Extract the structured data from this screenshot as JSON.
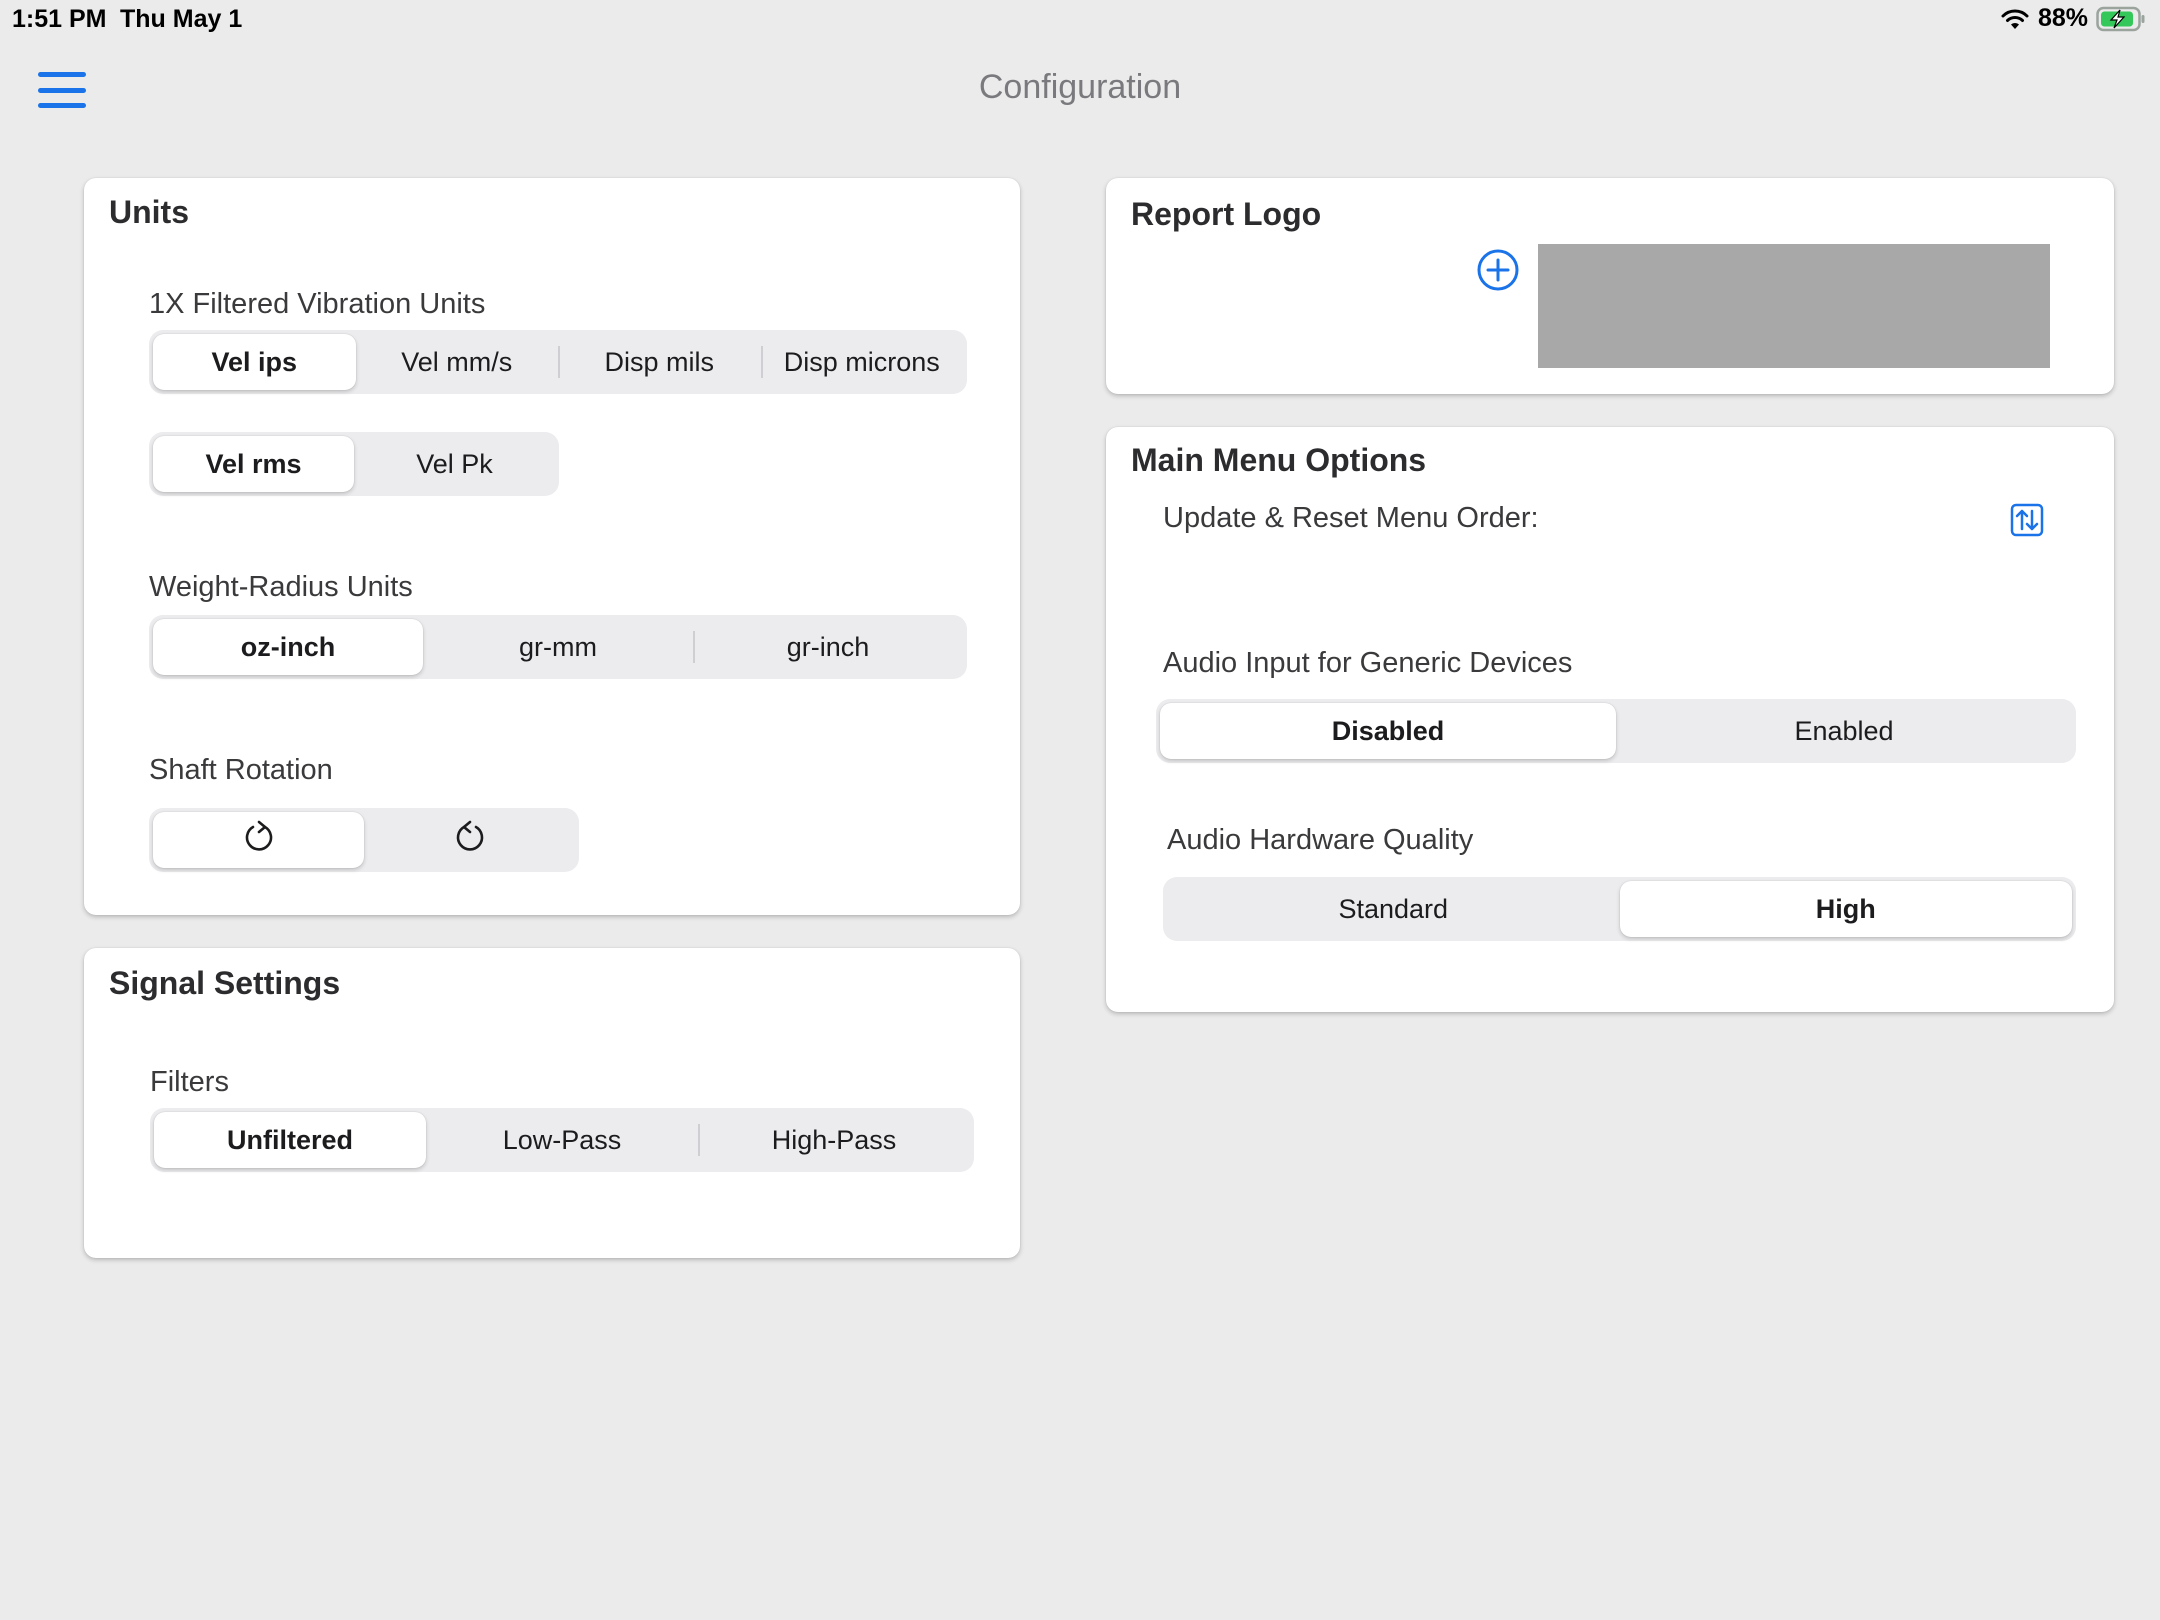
{
  "status_bar": {
    "time": "1:51 PM",
    "date": "Thu May 1",
    "battery": "88%",
    "icons": [
      "wifi-icon",
      "battery-charging-icon"
    ]
  },
  "nav": {
    "title": "Configuration",
    "menu_icon": "hamburger-menu-icon"
  },
  "colors": {
    "accent": "#1a73e8",
    "background": "#ebebeb",
    "card": "#ffffff",
    "logo_placeholder": "#a8a8a8"
  },
  "units": {
    "title": "Units",
    "vibration_label": "1X Filtered Vibration Units",
    "vibration_options": [
      "Vel ips",
      "Vel mm/s",
      "Disp mils",
      "Disp microns"
    ],
    "vibration_selected": "Vel ips",
    "measure_options": [
      "Vel rms",
      "Vel Pk"
    ],
    "measure_selected": "Vel rms",
    "weight_label": "Weight-Radius Units",
    "weight_options": [
      "oz-inch",
      "gr-mm",
      "gr-inch"
    ],
    "weight_selected": "oz-inch",
    "shaft_label": "Shaft Rotation",
    "shaft_options": [
      "rotate-clockwise-icon",
      "rotate-counterclockwise-icon"
    ],
    "shaft_selected": "rotate-clockwise-icon"
  },
  "signal": {
    "title": "Signal Settings",
    "filters_label": "Filters",
    "filter_options": [
      "Unfiltered",
      "Low-Pass",
      "High-Pass"
    ],
    "filter_selected": "Unfiltered"
  },
  "report_logo": {
    "title": "Report Logo",
    "add_icon": "plus-circle-icon"
  },
  "main_menu": {
    "title": "Main Menu Options",
    "reorder_label": "Update & Reset Menu Order:",
    "reorder_icon": "reorder-arrows-icon",
    "audio_input_label": "Audio Input for Generic Devices",
    "audio_input_options": [
      "Disabled",
      "Enabled"
    ],
    "audio_input_selected": "Disabled",
    "audio_quality_label": "Audio Hardware Quality",
    "audio_quality_options": [
      "Standard",
      "High"
    ],
    "audio_quality_selected": "High"
  }
}
